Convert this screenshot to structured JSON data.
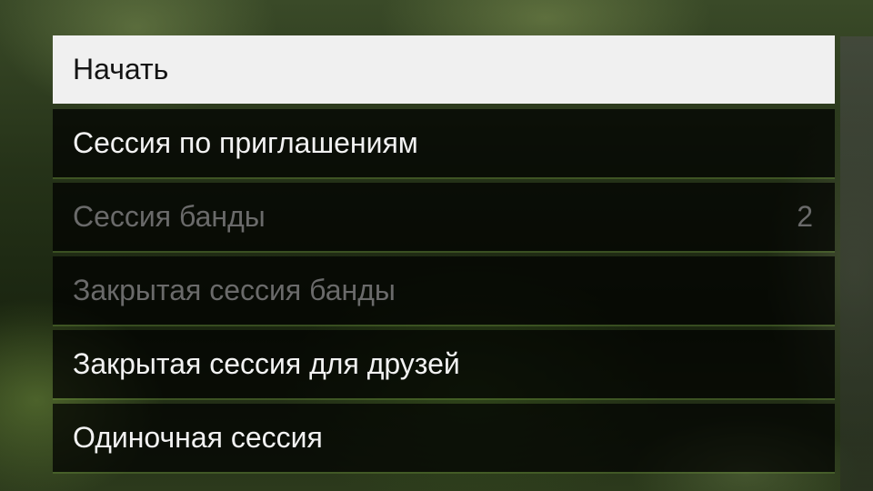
{
  "menu": {
    "items": [
      {
        "label": "Начать",
        "state": "selected"
      },
      {
        "label": "Сессия по приглашениям",
        "state": "enabled"
      },
      {
        "label": "Сессия банды",
        "state": "disabled",
        "count": "2"
      },
      {
        "label": "Закрытая сессия банды",
        "state": "disabled"
      },
      {
        "label": "Закрытая сессия для друзей",
        "state": "enabled"
      },
      {
        "label": "Одиночная сессия",
        "state": "enabled"
      }
    ]
  },
  "colors": {
    "selected_bg": "#f0f0f0",
    "item_bg": "#000000",
    "enabled_text": "#f2f2f2",
    "disabled_text": "#6a6a6a",
    "accent_line": "#6e963c"
  }
}
